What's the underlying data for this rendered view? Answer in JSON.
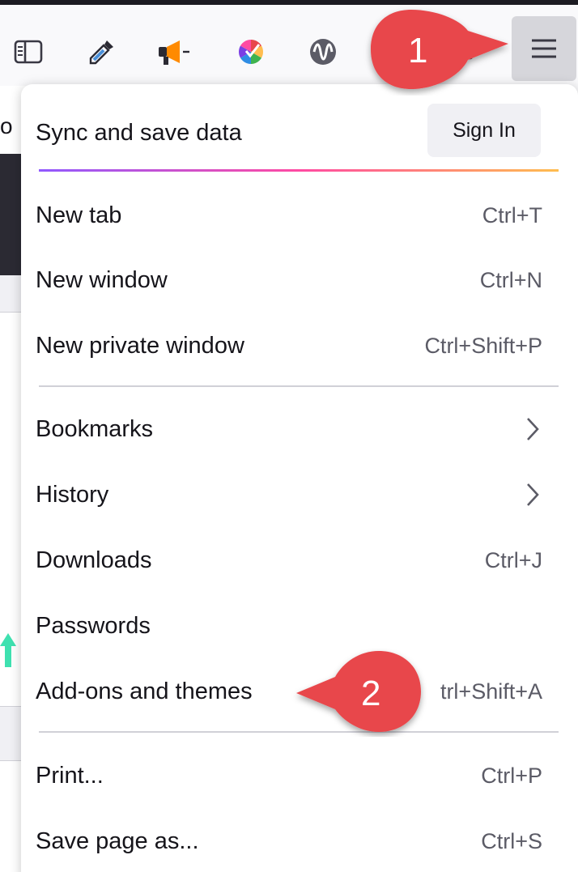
{
  "colors": {
    "accent_red": "#e8474b",
    "menu_text": "#15141a",
    "shortcut_text": "#5b5b66",
    "gradient": [
      "#9059ff",
      "#ff4aa2",
      "#ffbd4f"
    ]
  },
  "background_page": {
    "partial_text": "o"
  },
  "toolbar": {
    "icons": [
      "sidebar-icon",
      "eyedropper-icon",
      "megaphone-icon",
      "color-wheel-icon",
      "wave-icon"
    ],
    "menu_button_icon": "hamburger-icon"
  },
  "menu": {
    "sync": {
      "label": "Sync and save data",
      "button": "Sign In"
    },
    "items": [
      {
        "label": "New tab",
        "shortcut": "Ctrl+T"
      },
      {
        "label": "New window",
        "shortcut": "Ctrl+N"
      },
      {
        "label": "New private window",
        "shortcut": "Ctrl+Shift+P"
      },
      {
        "label": "Bookmarks",
        "submenu_icon": "chevron-right-icon"
      },
      {
        "label": "History",
        "submenu_icon": "chevron-right-icon"
      },
      {
        "label": "Downloads",
        "shortcut": "Ctrl+J"
      },
      {
        "label": "Passwords"
      },
      {
        "label": "Add-ons and themes",
        "shortcut": "trl+Shift+A"
      },
      {
        "label": "Print...",
        "shortcut": "Ctrl+P"
      },
      {
        "label": "Save page as...",
        "shortcut": "Ctrl+S"
      }
    ]
  },
  "callouts": [
    {
      "number": "1"
    },
    {
      "number": "2"
    }
  ]
}
